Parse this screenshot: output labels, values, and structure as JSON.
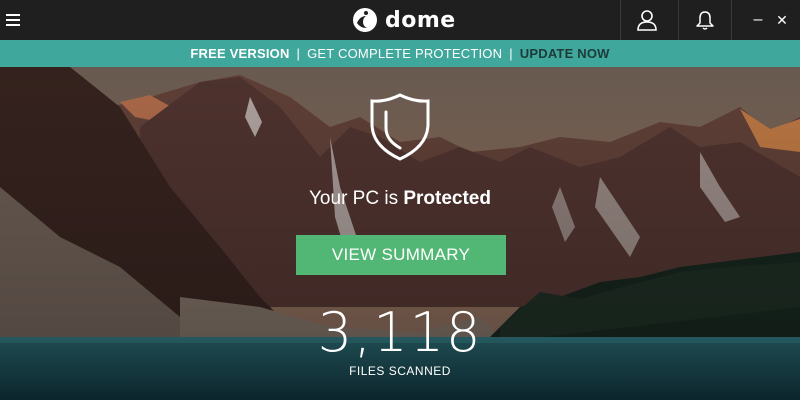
{
  "app": {
    "logo_text": "dome"
  },
  "banner": {
    "free_version": "FREE VERSION",
    "separator": "|",
    "get_protection": "GET COMPLETE PROTECTION",
    "update_now": "UPDATE NOW"
  },
  "status": {
    "prefix": "Your PC is",
    "state": "Protected"
  },
  "actions": {
    "view_summary": "VIEW SUMMARY"
  },
  "scan": {
    "files_count": "3,118",
    "files_label": "FILES SCANNED"
  },
  "window_controls": {
    "minimize": "–",
    "close": "✕"
  },
  "icons": {
    "menu": "hamburger-menu-icon",
    "account": "user-account-icon",
    "notifications": "bell-icon",
    "shield": "shield-icon",
    "logo": "dome-logo-icon"
  },
  "colors": {
    "titlebar": "#1f1f1f",
    "banner": "#3fa79c",
    "update_now": "#1d3b39",
    "button": "#52b775"
  }
}
